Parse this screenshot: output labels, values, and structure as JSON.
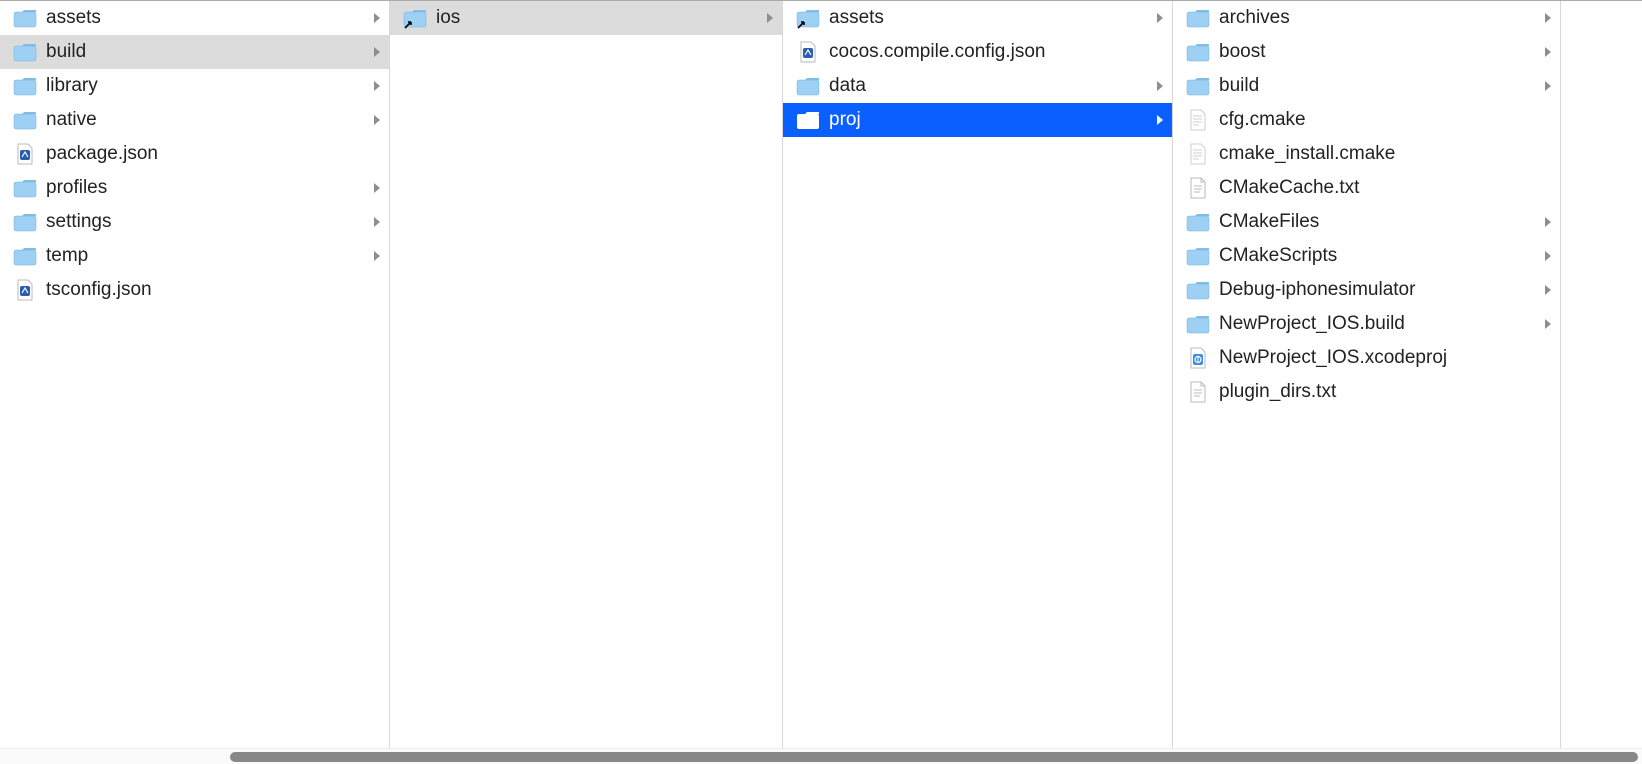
{
  "columns": [
    {
      "items": [
        {
          "name": "assets",
          "type": "folder",
          "hasChildren": true,
          "state": "normal"
        },
        {
          "name": "build",
          "type": "folder",
          "hasChildren": true,
          "state": "selected-inactive"
        },
        {
          "name": "library",
          "type": "folder",
          "hasChildren": true,
          "state": "normal"
        },
        {
          "name": "native",
          "type": "folder",
          "hasChildren": true,
          "state": "normal"
        },
        {
          "name": "package.json",
          "type": "xcfile",
          "hasChildren": false,
          "state": "normal"
        },
        {
          "name": "profiles",
          "type": "folder",
          "hasChildren": true,
          "state": "normal"
        },
        {
          "name": "settings",
          "type": "folder",
          "hasChildren": true,
          "state": "normal"
        },
        {
          "name": "temp",
          "type": "folder",
          "hasChildren": true,
          "state": "normal"
        },
        {
          "name": "tsconfig.json",
          "type": "xcfile",
          "hasChildren": false,
          "state": "normal"
        }
      ]
    },
    {
      "items": [
        {
          "name": "ios",
          "type": "folder-alias",
          "hasChildren": true,
          "state": "selected-inactive"
        }
      ]
    },
    {
      "items": [
        {
          "name": "assets",
          "type": "folder-alias",
          "hasChildren": true,
          "state": "normal"
        },
        {
          "name": "cocos.compile.config.json",
          "type": "xcfile",
          "hasChildren": false,
          "state": "normal"
        },
        {
          "name": "data",
          "type": "folder",
          "hasChildren": true,
          "state": "normal"
        },
        {
          "name": "proj",
          "type": "folder",
          "hasChildren": true,
          "state": "selected-active"
        }
      ]
    },
    {
      "items": [
        {
          "name": "archives",
          "type": "folder",
          "hasChildren": true,
          "state": "normal"
        },
        {
          "name": "boost",
          "type": "folder",
          "hasChildren": true,
          "state": "normal"
        },
        {
          "name": "build",
          "type": "folder",
          "hasChildren": true,
          "state": "normal"
        },
        {
          "name": "cfg.cmake",
          "type": "textfile",
          "hasChildren": false,
          "state": "normal"
        },
        {
          "name": "cmake_install.cmake",
          "type": "textfile",
          "hasChildren": false,
          "state": "normal"
        },
        {
          "name": "CMakeCache.txt",
          "type": "docfile",
          "hasChildren": false,
          "state": "normal"
        },
        {
          "name": "CMakeFiles",
          "type": "folder",
          "hasChildren": true,
          "state": "normal"
        },
        {
          "name": "CMakeScripts",
          "type": "folder",
          "hasChildren": true,
          "state": "normal"
        },
        {
          "name": "Debug-iphonesimulator",
          "type": "folder",
          "hasChildren": true,
          "state": "normal"
        },
        {
          "name": "NewProject_IOS.build",
          "type": "folder",
          "hasChildren": true,
          "state": "normal"
        },
        {
          "name": "NewProject_IOS.xcodeproj",
          "type": "xcodeproj",
          "hasChildren": false,
          "state": "normal"
        },
        {
          "name": "plugin_dirs.txt",
          "type": "docfile",
          "hasChildren": false,
          "state": "normal"
        }
      ]
    }
  ]
}
